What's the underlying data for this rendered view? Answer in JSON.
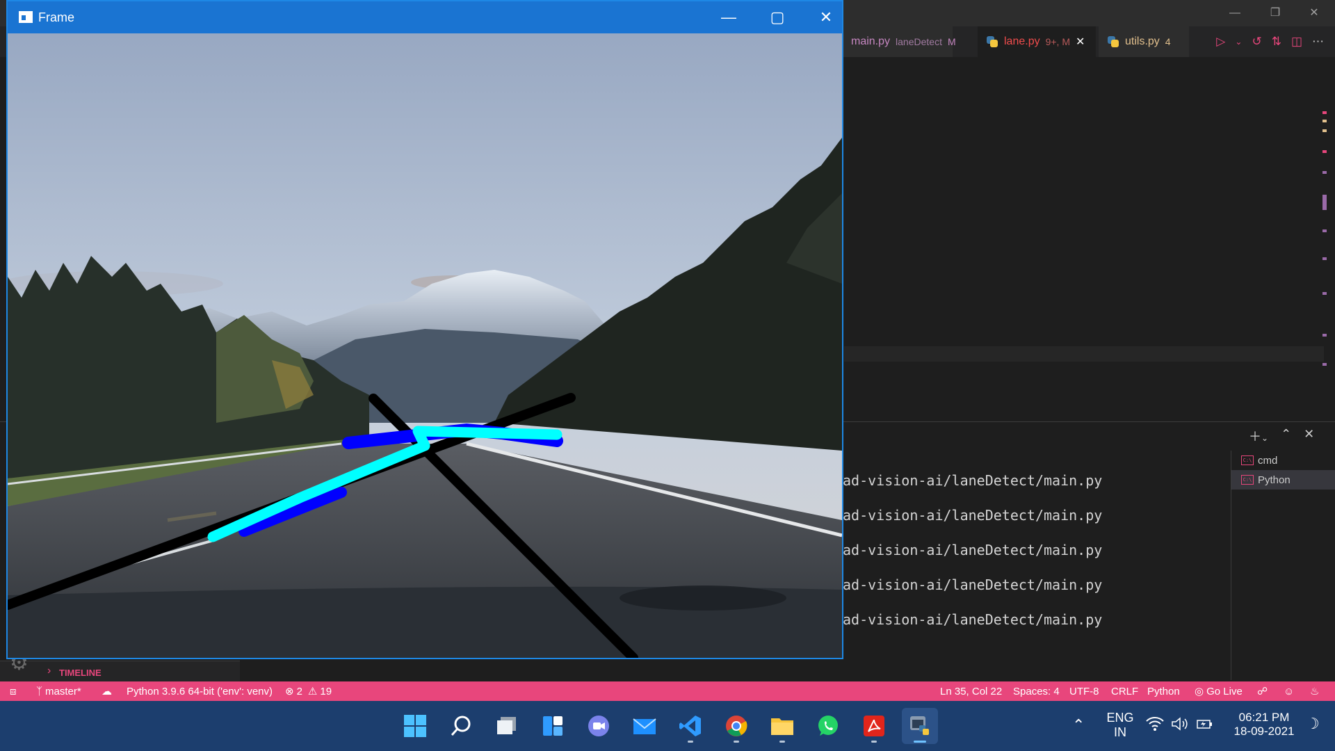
{
  "frame_window": {
    "title": "Frame",
    "icon": "opencv-window-icon",
    "controls": [
      "minimize-icon",
      "maximize-icon",
      "close-icon"
    ]
  },
  "vscode": {
    "tabs": [
      {
        "label": "main.py",
        "detail": "laneDetect",
        "badge": "M",
        "color": "#c586c0"
      },
      {
        "label": "lane.py",
        "detail": "9+, M",
        "color": "#f14c4c",
        "active": true
      },
      {
        "label": "utils.py",
        "detail": "4",
        "color": "#e2c08d"
      }
    ],
    "terminal_lines": [
      "ad-vision-ai/laneDetect/main.py",
      "ad-vision-ai/laneDetect/main.py",
      "ad-vision-ai/laneDetect/main.py",
      "ad-vision-ai/laneDetect/main.py",
      "ad-vision-ai/laneDetect/main.py"
    ],
    "terminals": [
      "cmd",
      "Python"
    ],
    "selected_terminal": "Python",
    "timeline_label": "TIMELINE"
  },
  "statusbar": {
    "branch": "master*",
    "interpreter": "Python 3.9.6 64-bit ('env': venv)",
    "errors": "2",
    "warnings": "19",
    "position": "Ln 35, Col 22",
    "spaces": "Spaces: 4",
    "encoding": "UTF-8",
    "eol": "CRLF",
    "language": "Python",
    "golive": "Go Live",
    "background": "#e8467c"
  },
  "taskbar": {
    "apps": [
      "windows-start-icon",
      "search-icon",
      "task-view-icon",
      "widgets-icon",
      "teams-chat-icon",
      "mail-icon",
      "vscode-icon",
      "chrome-icon",
      "file-explorer-icon",
      "whatsapp-icon",
      "acrobat-icon",
      "python-icon"
    ],
    "lang_top": "ENG",
    "lang_bottom": "IN",
    "time": "06:21 PM",
    "date": "18-09-2021"
  }
}
